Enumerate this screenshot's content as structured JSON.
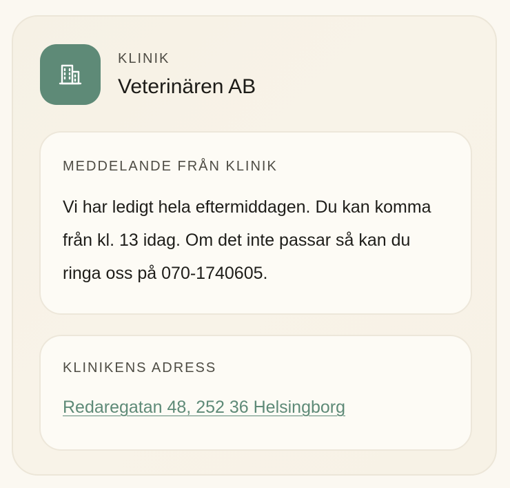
{
  "clinic": {
    "eyebrow": "KLINIK",
    "name": "Veterinären AB",
    "icon": "building-icon",
    "accent_color": "#5e8a77"
  },
  "message": {
    "label": "MEDDELANDE FRÅN KLINIK",
    "text": "Vi har ledigt hela eftermiddagen. Du kan komma från kl. 13 idag. Om det inte passar så kan du ringa oss på 070-1740605."
  },
  "address": {
    "label": "KLINIKENS ADRESS",
    "link_text": "Redaregatan 48, 252 36 Helsingborg"
  }
}
